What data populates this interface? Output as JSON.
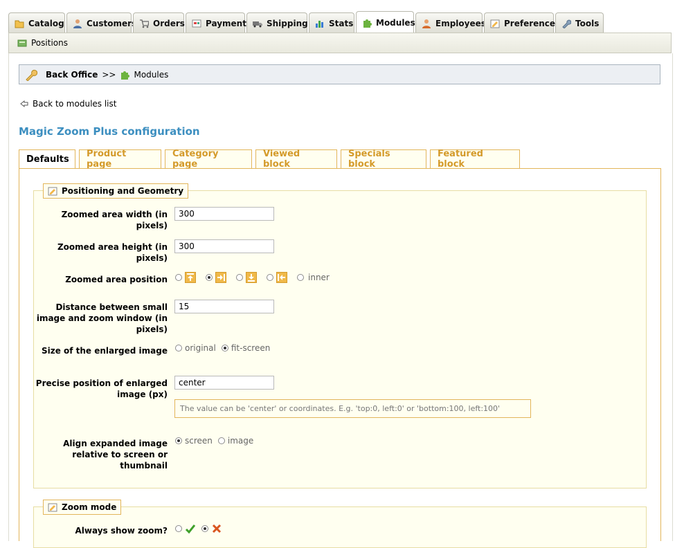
{
  "top_tabs": [
    {
      "label": "Catalog",
      "icon": "folder-icon",
      "active": false
    },
    {
      "label": "Customers",
      "icon": "customer-icon",
      "active": false
    },
    {
      "label": "Orders",
      "icon": "cart-icon",
      "active": false
    },
    {
      "label": "Payment",
      "icon": "payment-icon",
      "active": false
    },
    {
      "label": "Shipping",
      "icon": "truck-icon",
      "active": false
    },
    {
      "label": "Stats",
      "icon": "stats-icon",
      "active": false
    },
    {
      "label": "Modules",
      "icon": "puzzle-icon",
      "active": true
    },
    {
      "label": "Employees",
      "icon": "employee-icon",
      "active": false
    },
    {
      "label": "Preferences",
      "icon": "preferences-icon",
      "active": false
    },
    {
      "label": "Tools",
      "icon": "wrench-icon",
      "active": false
    }
  ],
  "subbar": {
    "label": "Positions",
    "icon": "positions-icon"
  },
  "breadcrumb": {
    "root": "Back Office",
    "separator": ">>",
    "current": "Modules"
  },
  "back_link": "Back to modules list",
  "config_title": "Magic Zoom Plus configuration",
  "inner_tabs": [
    {
      "label": "Defaults",
      "active": true
    },
    {
      "label": "Product page",
      "active": false
    },
    {
      "label": "Category page",
      "active": false
    },
    {
      "label": "Viewed block",
      "active": false
    },
    {
      "label": "Specials block",
      "active": false
    },
    {
      "label": "Featured block",
      "active": false
    }
  ],
  "section1": {
    "title": "Positioning and Geometry",
    "width_label": "Zoomed area width (in pixels)",
    "width_value": "300",
    "height_label": "Zoomed area height (in pixels)",
    "height_value": "300",
    "position_label": "Zoomed area position",
    "position_inner": "inner",
    "distance_label": "Distance between small image and zoom window (in pixels)",
    "distance_value": "15",
    "size_label": "Size of the enlarged image",
    "size_original": "original",
    "size_fit": "fit-screen",
    "precise_label": "Precise position of enlarged image (px)",
    "precise_value": "center",
    "precise_hint": "The value can be 'center' or coordinates. E.g. 'top:0, left:0' or 'bottom:100, left:100'",
    "align_label": "Align expanded image relative to screen or thumbnail",
    "align_screen": "screen",
    "align_image": "image"
  },
  "section2": {
    "title": "Zoom mode",
    "always_label": "Always show zoom?"
  },
  "colors": {
    "accent": "#3d8fc0",
    "tab_text": "#d49a2a",
    "border": "#e2b55a",
    "panel_bg": "#fffff0"
  }
}
